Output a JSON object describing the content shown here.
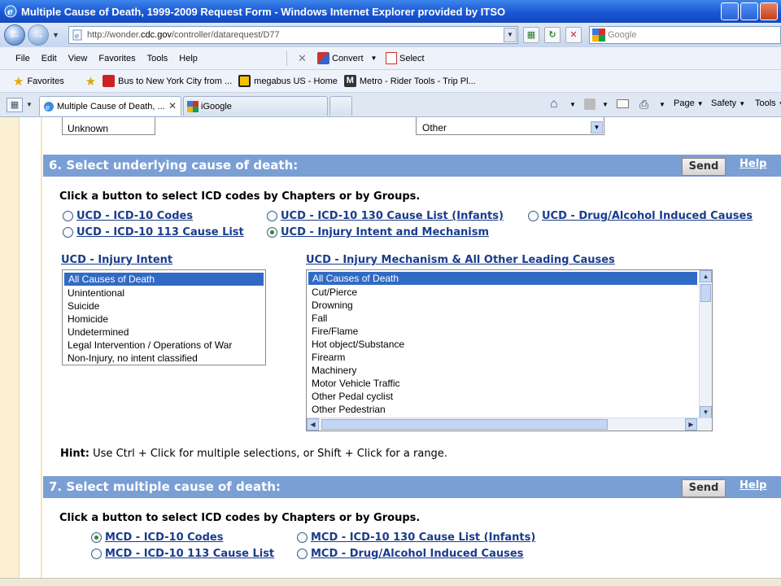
{
  "window": {
    "title": "Multiple Cause of Death, 1999-2009 Request Form - Windows Internet Explorer provided by ITSO"
  },
  "nav": {
    "url_prefix": "http://wonder.",
    "url_host": "cdc.gov",
    "url_suffix": "/controller/datarequest/D77",
    "search_placeholder": "Google"
  },
  "menu": {
    "items": [
      "File",
      "Edit",
      "View",
      "Favorites",
      "Tools",
      "Help"
    ],
    "convert_label": "Convert",
    "select_label": "Select"
  },
  "favorites": {
    "label": "Favorites",
    "items": [
      "Bus to New York City from ...",
      "megabus US - Home",
      "Metro - Rider Tools - Trip Pl..."
    ]
  },
  "tabs": {
    "active_label": "Multiple Cause of Death, ...",
    "inactive_label": "iGoogle"
  },
  "command_bar": {
    "page_label": "Page",
    "safety_label": "Safety",
    "tools_label": "Tools"
  },
  "top_partial": {
    "left_list_last": "Unknown",
    "right_select_value": "Other"
  },
  "section6": {
    "title": "6. Select underlying cause of death:",
    "send_label": "Send",
    "help_label": "Help",
    "instruction": "Click a button to select ICD codes by Chapters or by Groups.",
    "radio_options": [
      "UCD - ICD-10 Codes",
      "UCD - ICD-10 130 Cause List (Infants)",
      "UCD - Drug/Alcohol Induced Causes",
      "UCD - ICD-10 113 Cause List",
      "UCD - Injury Intent and Mechanism"
    ],
    "selected_radio": "UCD - Injury Intent and Mechanism",
    "intent_title": "UCD - Injury Intent",
    "intent_options": [
      "All Causes of Death",
      "Unintentional",
      "Suicide",
      "Homicide",
      "Undetermined",
      "Legal Intervention / Operations of War",
      "Non-Injury, no intent classified"
    ],
    "mechanism_title": "UCD - Injury Mechanism & All Other Leading Causes",
    "mechanism_options": [
      "All Causes of Death",
      "Cut/Pierce",
      "Drowning",
      "Fall",
      "Fire/Flame",
      "Hot object/Substance",
      "Firearm",
      "Machinery",
      "Motor Vehicle Traffic",
      "Other Pedal cyclist",
      "Other Pedestrian"
    ],
    "hint_bold": "Hint:",
    "hint_text": " Use Ctrl + Click for multiple selections, or Shift + Click for a range."
  },
  "section7": {
    "title": "7. Select multiple cause of death:",
    "send_label": "Send",
    "help_label": "Help",
    "instruction": "Click a button to select ICD codes by Chapters or by Groups.",
    "radio_options": [
      "MCD - ICD-10 Codes",
      "MCD - ICD-10 130 Cause List (Infants)",
      "MCD - ICD-10 113 Cause List",
      "MCD - Drug/Alcohol Induced Causes"
    ],
    "selected_radio": "MCD - ICD-10 Codes"
  }
}
